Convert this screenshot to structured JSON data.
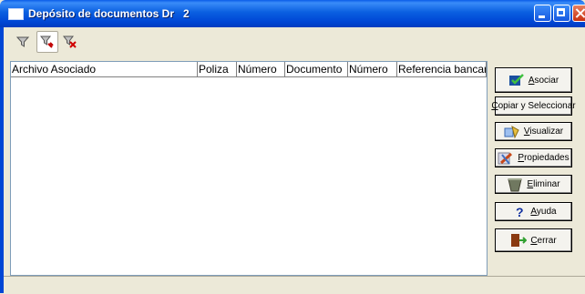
{
  "window": {
    "title": "Depósito de documentos Dr   2"
  },
  "toolbar": {
    "buttons": [
      {
        "name": "filter",
        "pressed": false
      },
      {
        "name": "filter-edit",
        "pressed": true
      },
      {
        "name": "filter-remove",
        "pressed": false
      }
    ]
  },
  "grid": {
    "columns": [
      "Archivo Asociado",
      "Poliza",
      "Número",
      "Documento",
      "Número",
      "Referencia bancaria"
    ],
    "rows": []
  },
  "actions": {
    "asociar": "Asociar",
    "copiar": "Copiar y Seleccionar",
    "visualizar": "Visualizar",
    "propiedades": "Propiedades",
    "eliminar": "Eliminar",
    "ayuda": "Ayuda",
    "cerrar": "Cerrar"
  },
  "colors": {
    "titlebar": "#0046d5",
    "face": "#ece9d8"
  }
}
